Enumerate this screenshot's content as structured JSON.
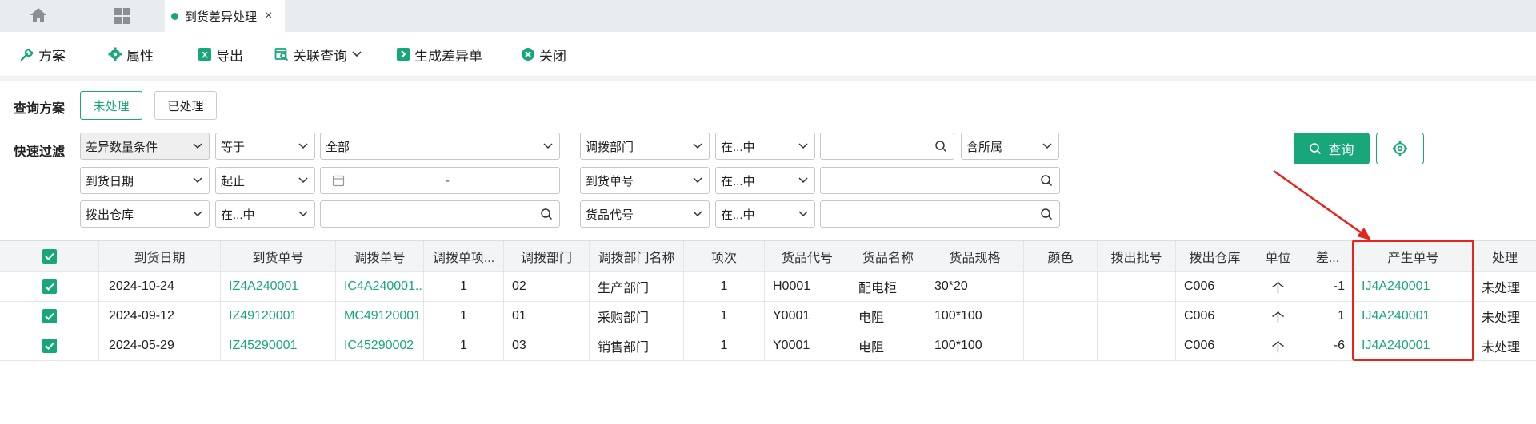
{
  "tabs": {
    "active_tab_label": "到货差异处理",
    "close": "×",
    "accent": "#17a77b"
  },
  "toolbar": {
    "plan": "方案",
    "property": "属性",
    "export": "导出",
    "related_query": "关联查询",
    "generate": "生成差异单",
    "close": "关闭"
  },
  "query_plan": {
    "label": "查询方案",
    "options": [
      "未处理",
      "已处理"
    ],
    "selected": "未处理"
  },
  "quick_filter": {
    "label": "快速过滤",
    "rows": [
      {
        "field1": "差异数量条件",
        "op1": "等于",
        "value1": "全部",
        "field2": "调拨部门",
        "op2": "在...中",
        "value2": "",
        "extra2": "含所属"
      },
      {
        "field1": "到货日期",
        "op1": "起止",
        "value1_sep": "-",
        "field2": "到货单号",
        "op2": "在...中",
        "value2": ""
      },
      {
        "field1": "拨出仓库",
        "op1": "在...中",
        "value1": "",
        "field2": "货品代号",
        "op2": "在...中",
        "value2": ""
      }
    ],
    "query_button": "查询"
  },
  "table": {
    "columns": [
      "到货日期",
      "到货单号",
      "调拨单号",
      "调拨单项...",
      "调拨部门",
      "调拨部门名称",
      "项次",
      "货品代号",
      "货品名称",
      "货品规格",
      "颜色",
      "拨出批号",
      "拨出仓库",
      "单位",
      "差...",
      "产生单号",
      "处理"
    ],
    "rows": [
      [
        "2024-10-24",
        "IZ4A240001",
        "IC4A240001...",
        "1",
        "02",
        "生产部门",
        "1",
        "H0001",
        "配电柜",
        "30*20",
        "",
        "",
        "C006",
        "个",
        "-1",
        "IJ4A240001",
        "未处理"
      ],
      [
        "2024-09-12",
        "IZ49120001",
        "MC49120001",
        "1",
        "01",
        "采购部门",
        "1",
        "Y0001",
        "电阻",
        "100*100",
        "",
        "",
        "C006",
        "个",
        "1",
        "IJ4A240001",
        "未处理"
      ],
      [
        "2024-05-29",
        "IZ45290001",
        "IC45290002",
        "1",
        "03",
        "销售部门",
        "1",
        "Y0001",
        "电阻",
        "100*100",
        "",
        "",
        "C006",
        "个",
        "-6",
        "IJ4A240001",
        "未处理"
      ]
    ]
  }
}
